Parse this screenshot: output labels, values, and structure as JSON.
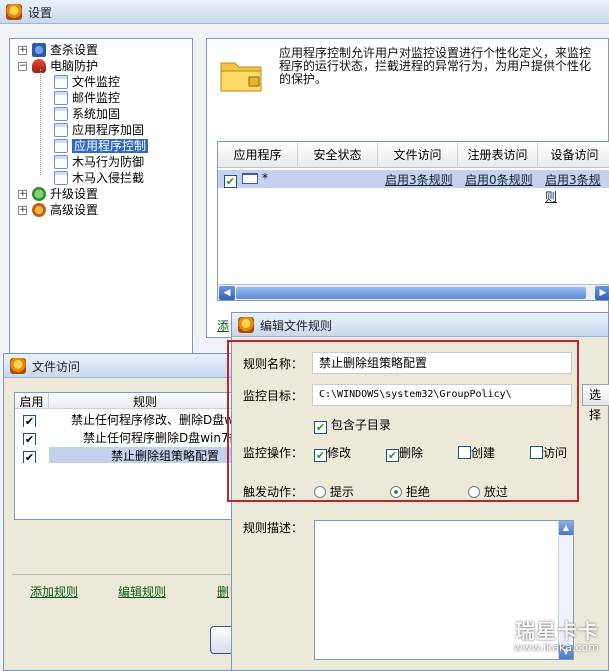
{
  "main_window": {
    "title": "设置"
  },
  "tree": {
    "items": [
      {
        "label": "查杀设置",
        "level": 0,
        "expander": "+"
      },
      {
        "label": "电脑防护",
        "level": 0,
        "expander": "−"
      },
      {
        "label": "文件监控",
        "level": 1
      },
      {
        "label": "邮件监控",
        "level": 1
      },
      {
        "label": "系统加固",
        "level": 1
      },
      {
        "label": "应用程序加固",
        "level": 1
      },
      {
        "label": "应用程序控制",
        "level": 1,
        "selected": true
      },
      {
        "label": "木马行为防御",
        "level": 1
      },
      {
        "label": "木马入侵拦截",
        "level": 1
      },
      {
        "label": "升级设置",
        "level": 0,
        "expander": "+"
      },
      {
        "label": "高级设置",
        "level": 0,
        "expander": "+"
      }
    ]
  },
  "right": {
    "description": "应用程序控制允许用户对监控设置进行个性化定义，来监控程序的运行状态，拦截进程的异常行为，为用户提供个性化的保护。",
    "table": {
      "headers": [
        "应用程序",
        "安全状态",
        "文件访问",
        "注册表访问",
        "设备访问"
      ],
      "rows": [
        {
          "app": "*",
          "status": "",
          "file": "启用3条规则",
          "registry": "启用0条规则",
          "device": "启用3条规则"
        }
      ]
    },
    "add_link_fragment": "添"
  },
  "file_dialog": {
    "title": "文件访问",
    "headers": [
      "启用",
      "规则"
    ],
    "rules": [
      "禁止任何程序修改、删除D盘w",
      "禁止任何程序删除D盘win7备",
      "禁止删除组策略配置"
    ],
    "links": [
      "添加规则",
      "编辑规则",
      "删"
    ]
  },
  "edit_dialog": {
    "title": "编辑文件规则",
    "rule_name_label": "规则名称：",
    "rule_name_value": "禁止删除组策略配置",
    "target_label": "监控目标：",
    "target_value": "C:\\WINDOWS\\system32\\GroupPolicy\\",
    "browse_label": "选择",
    "include_sub_label": "包含子目录",
    "ops_label": "监控操作：",
    "ops": [
      {
        "label": "修改",
        "checked": true
      },
      {
        "label": "删除",
        "checked": true
      },
      {
        "label": "创建",
        "checked": false
      },
      {
        "label": "访问",
        "checked": false
      }
    ],
    "action_label": "触发动作：",
    "actions": [
      {
        "label": "提示",
        "selected": false
      },
      {
        "label": "拒绝",
        "selected": true
      },
      {
        "label": "放过",
        "selected": false
      }
    ],
    "desc_label": "规则描述："
  },
  "watermark": {
    "brand": "瑞星卡卡",
    "url": "www.ikaka.com"
  },
  "colors": {
    "highlight_border": "#b4282e",
    "selected_row": "#c5d2ee",
    "tree_selected": "#3169c6"
  }
}
